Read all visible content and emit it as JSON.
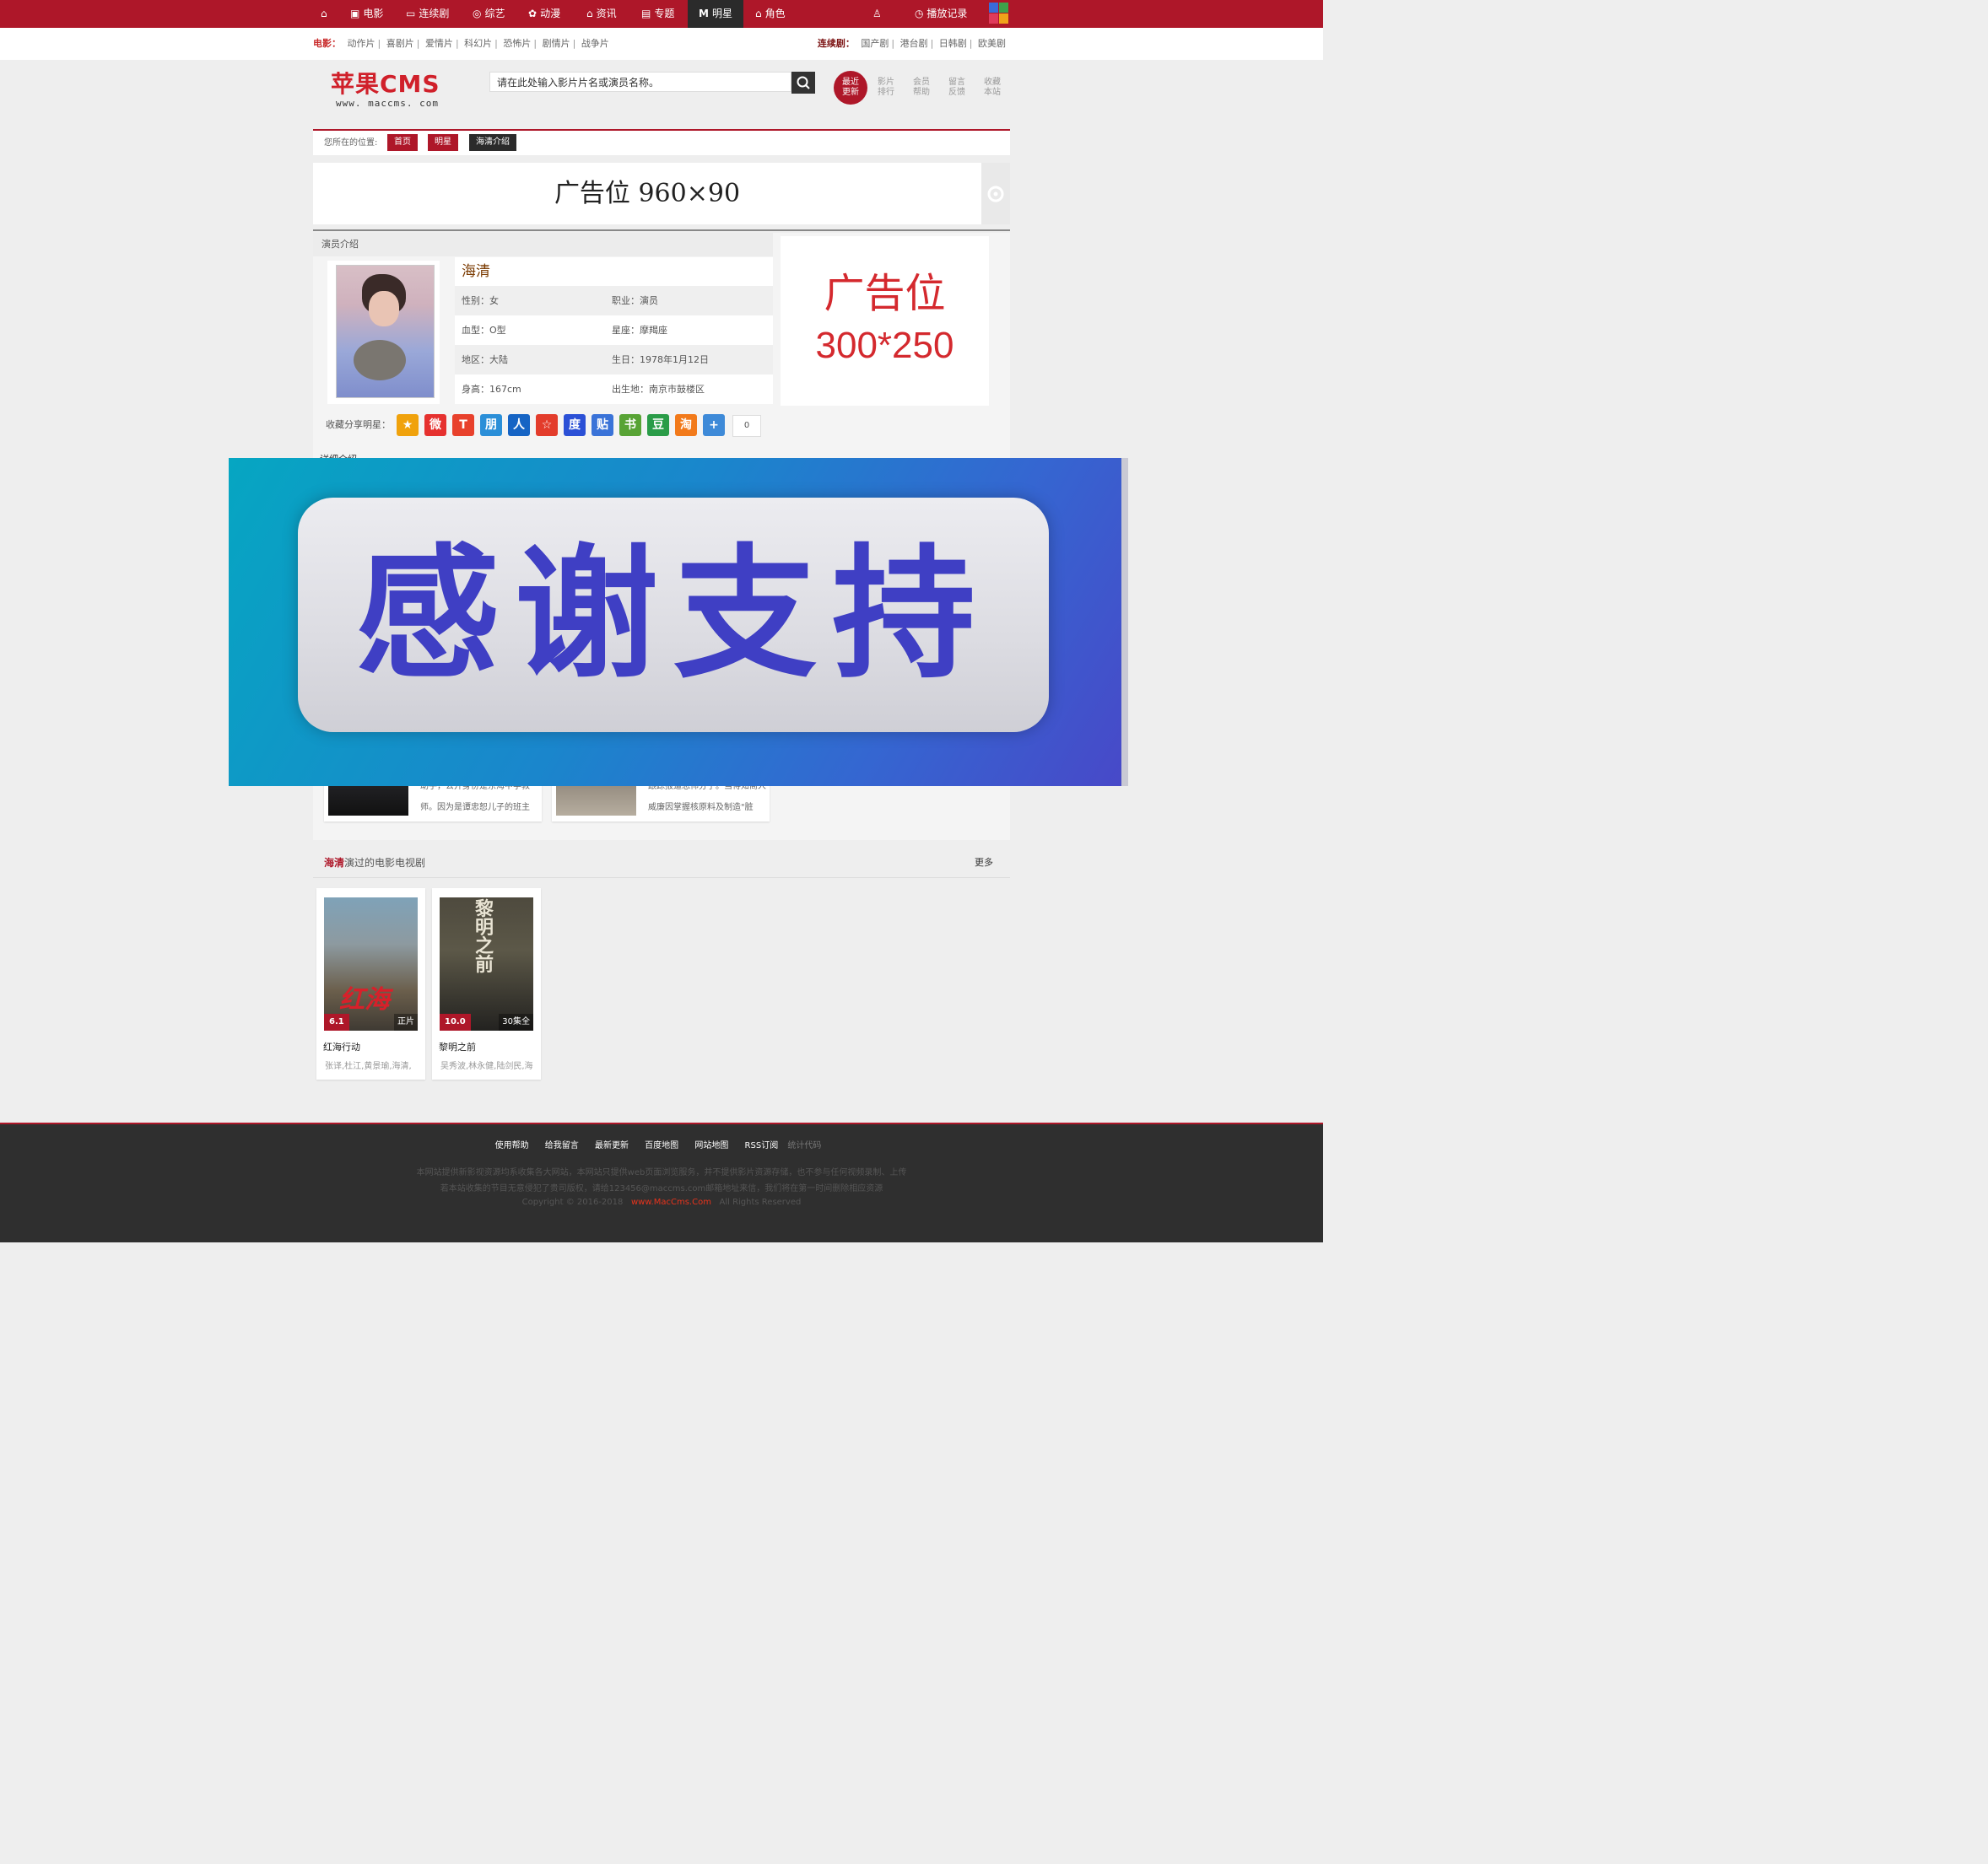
{
  "nav": {
    "items": [
      {
        "label": "电影",
        "icon": "film-icon"
      },
      {
        "label": "连续剧",
        "icon": "tv-icon"
      },
      {
        "label": "综艺",
        "icon": "variety-icon"
      },
      {
        "label": "动漫",
        "icon": "anime-icon"
      },
      {
        "label": "资讯",
        "icon": "news-icon"
      },
      {
        "label": "专题",
        "icon": "topic-icon"
      },
      {
        "label": "明星",
        "icon": "star-m-icon"
      },
      {
        "label": "角色",
        "icon": "role-icon"
      }
    ],
    "active_index": 6,
    "history_label": "播放记录"
  },
  "subnav": {
    "movie_label": "电影：",
    "movie_items": [
      "动作片",
      "喜剧片",
      "爱情片",
      "科幻片",
      "恐怖片",
      "剧情片",
      "战争片"
    ],
    "series_label": "连续剧：",
    "series_items": [
      "国产剧",
      "港台剧",
      "日韩剧",
      "欧美剧"
    ]
  },
  "header": {
    "logo_main": "苹果CMS",
    "logo_url": "www. maccms. com",
    "search_placeholder": "请在此处输入影片片名或演员名称。",
    "buttons": [
      {
        "l1": "最近",
        "l2": "更新"
      },
      {
        "l1": "影片",
        "l2": "排行"
      },
      {
        "l1": "会员",
        "l2": "帮助"
      },
      {
        "l1": "留言",
        "l2": "反馈"
      },
      {
        "l1": "收藏",
        "l2": "本站"
      }
    ]
  },
  "breadcrumb": {
    "prefix": "您所在的位置:",
    "items": [
      "首页",
      "明星",
      "海清介绍"
    ]
  },
  "ads": {
    "banner": "广告位  960×90",
    "box_l1": "广告位",
    "box_l2": "300*250"
  },
  "actor": {
    "section_title": "演员介绍",
    "name": "海清",
    "fields": [
      [
        "性别：女",
        "职业：演员"
      ],
      [
        "血型：O型",
        "星座：摩羯座"
      ],
      [
        "地区：大陆",
        "生日：1978年1月12日"
      ],
      [
        "身高：167cm",
        "出生地：南京市鼓楼区"
      ]
    ],
    "share_label": "收藏分享明星：",
    "share_icons": [
      {
        "icon": "qzone-star-icon",
        "color": "#f0a20c",
        "glyph": "★"
      },
      {
        "icon": "weibo-icon",
        "color": "#e6312f",
        "glyph": "微"
      },
      {
        "icon": "tencent-weibo-icon",
        "color": "#e8412c",
        "glyph": "T"
      },
      {
        "icon": "pengyou-icon",
        "color": "#2b8fd8",
        "glyph": "朋"
      },
      {
        "icon": "renren-icon",
        "color": "#1664c4",
        "glyph": "人"
      },
      {
        "icon": "kaixin-icon",
        "color": "#e33c2b",
        "glyph": "☆"
      },
      {
        "icon": "baidu-icon",
        "color": "#2b50d6",
        "glyph": "度"
      },
      {
        "icon": "tieba-icon",
        "color": "#3a73d8",
        "glyph": "贴"
      },
      {
        "icon": "qq-bookmark-icon",
        "color": "#58a335",
        "glyph": "书"
      },
      {
        "icon": "douban-icon",
        "color": "#2a9c48",
        "glyph": "豆"
      },
      {
        "icon": "taobao-icon",
        "color": "#f27a1b",
        "glyph": "淘"
      },
      {
        "icon": "more-share-icon",
        "color": "#3e8ad8",
        "glyph": "+"
      }
    ],
    "share_count": "0"
  },
  "detail": {
    "heading_partial": "详细介绍",
    "roles": [
      {
        "text1": "助手，公开身份是东海中学教",
        "text2": "师。因为是谭忠恕儿子的班主"
      },
      {
        "text1": "跟踪报道恐怖分子。当得知商人",
        "text2": "威廉因掌握核原料及制造\"脏"
      }
    ]
  },
  "overlay": {
    "text": "感谢支持"
  },
  "films": {
    "name": "海清",
    "heading_suffix": "演过的电影电视剧",
    "more": "更多",
    "items": [
      {
        "title": "红海行动",
        "score": "6.1",
        "status": "正片",
        "cast": "张译,杜江,黄景瑜,海清,"
      },
      {
        "title": "黎明之前",
        "score": "10.0",
        "status": "30集全",
        "cast": "吴秀波,林永健,陆剑民,海"
      }
    ]
  },
  "footer": {
    "links": [
      "使用帮助",
      "给我留言",
      "最新更新",
      "百度地图",
      "网站地图",
      "RSS订阅"
    ],
    "stat": "统计代码",
    "line1": "本网站提供新影视资源均系收集各大网站，本网站只提供web页面浏览服务，并不提供影片资源存储，也不参与任何视频录制、上传",
    "line2": "若本站收集的节目无意侵犯了贵司版权，请给123456@maccms.com邮箱地址来信，我们将在第一时间删除相应资源",
    "copyright": "Copyright © 2016-2018",
    "brand": "www.MacCms.Com",
    "rights": "All Rights Reserved"
  },
  "colors": {
    "brand_red": "#ae1729",
    "dark": "#2b2b2b",
    "overlay_blue": "#3f3fc4"
  }
}
